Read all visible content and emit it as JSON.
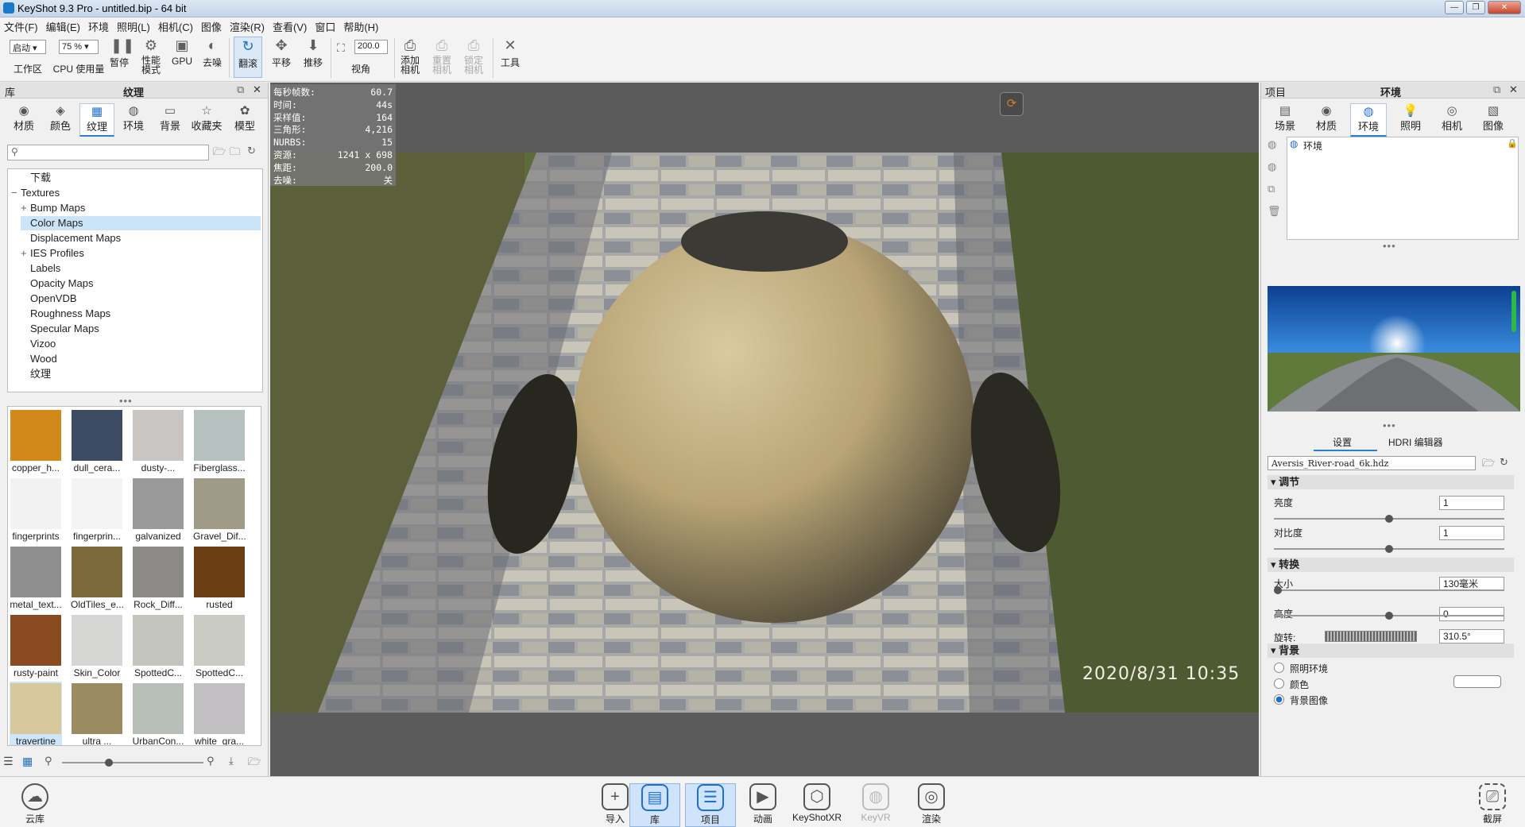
{
  "window": {
    "title": "KeyShot 9.3 Pro  - untitled.bip  - 64 bit",
    "minimize": "—",
    "restore": "❐",
    "close": "✕"
  },
  "menu": [
    "文件(F)",
    "编辑(E)",
    "环境",
    "照明(L)",
    "相机(C)",
    "图像",
    "渲染(R)",
    "查看(V)",
    "窗口",
    "帮助(H)"
  ],
  "toolbar": {
    "workspace_value": "启动",
    "workspace_label": "工作区",
    "cpu_value": "75 %",
    "cpu_label": "CPU 使用量",
    "pause": "暂停",
    "perf": "性能\n模式",
    "gpu": "GPU",
    "denoise": "去噪",
    "tumble": "翻滚",
    "pan": "平移",
    "dolly": "推移",
    "fov_value": "200.0",
    "fov_label": "视角",
    "add_camera": "添加\n相机",
    "reset_camera": "重置\n相机",
    "lock_camera": "锁定\n相机",
    "tools": "工具"
  },
  "library": {
    "header": "库",
    "title": "纹理",
    "tabs": [
      "材质",
      "颜色",
      "纹理",
      "环境",
      "背景",
      "收藏夹",
      "模型"
    ],
    "active_tab": "纹理",
    "search_placeholder": "",
    "tree": [
      {
        "label": "下载",
        "indent": 1,
        "toggle": ""
      },
      {
        "label": "Textures",
        "indent": 0,
        "toggle": "−"
      },
      {
        "label": "Bump Maps",
        "indent": 1,
        "toggle": "+"
      },
      {
        "label": "Color Maps",
        "indent": 1,
        "toggle": "",
        "selected": true
      },
      {
        "label": "Displacement Maps",
        "indent": 1,
        "toggle": ""
      },
      {
        "label": "IES Profiles",
        "indent": 1,
        "toggle": "+"
      },
      {
        "label": "Labels",
        "indent": 1,
        "toggle": ""
      },
      {
        "label": "Opacity Maps",
        "indent": 1,
        "toggle": ""
      },
      {
        "label": "OpenVDB",
        "indent": 1,
        "toggle": ""
      },
      {
        "label": "Roughness Maps",
        "indent": 1,
        "toggle": ""
      },
      {
        "label": "Specular Maps",
        "indent": 1,
        "toggle": ""
      },
      {
        "label": "Vizoo",
        "indent": 1,
        "toggle": ""
      },
      {
        "label": "Wood",
        "indent": 1,
        "toggle": ""
      },
      {
        "label": "纹理",
        "indent": 1,
        "toggle": ""
      }
    ],
    "thumbnails": [
      {
        "label": "copper_h...",
        "color": "#d18a1a"
      },
      {
        "label": "dull_cera...",
        "color": "#3d4c62"
      },
      {
        "label": "dusty-...",
        "color": "#c9c5c3"
      },
      {
        "label": "Fiberglass...",
        "color": "#b6c1bf"
      },
      {
        "label": "fingerprints",
        "color": "#f2f2f2"
      },
      {
        "label": "fingerprin...",
        "color": "#f4f4f4"
      },
      {
        "label": "galvanized",
        "color": "#9a9a9a"
      },
      {
        "label": "Gravel_Dif...",
        "color": "#a09a88"
      },
      {
        "label": "metal_text...",
        "color": "#8f8f8f"
      },
      {
        "label": "OldTiles_e...",
        "color": "#7d6a3c"
      },
      {
        "label": "Rock_Diff...",
        "color": "#8c8a86"
      },
      {
        "label": "rusted",
        "color": "#6b3e14"
      },
      {
        "label": "rusty-paint",
        "color": "#8a4a22"
      },
      {
        "label": "Skin_Color",
        "color": "#d6d6d4"
      },
      {
        "label": "SpottedC...",
        "color": "#c3c4bc"
      },
      {
        "label": "SpottedC...",
        "color": "#c9cbc2"
      },
      {
        "label": "travertine",
        "color": "#d8c99c",
        "selected": true
      },
      {
        "label": "ultra ...",
        "color": "#9a8b62"
      },
      {
        "label": "UrbanCon...",
        "color": "#b7bfb8"
      },
      {
        "label": "white_gra...",
        "color": "#c2bfc3"
      }
    ]
  },
  "hud": [
    {
      "k": "每秒帧数:",
      "v": "60.7"
    },
    {
      "k": "时间:",
      "v": "44s"
    },
    {
      "k": "采样值:",
      "v": "164"
    },
    {
      "k": "三角形:",
      "v": "4,216"
    },
    {
      "k": "NURBS:",
      "v": "15"
    },
    {
      "k": "资源:",
      "v": "1241 x 698"
    },
    {
      "k": "焦距:",
      "v": "200.0"
    },
    {
      "k": "去噪:",
      "v": "关"
    }
  ],
  "viewport": {
    "timestamp": "2020/8/31  10:35"
  },
  "project": {
    "header": "项目",
    "title": "环境",
    "tabs": [
      "场景",
      "材质",
      "环境",
      "照明",
      "相机",
      "图像"
    ],
    "active_tab": "环境",
    "env_item": "环境",
    "subtabs": [
      "设置",
      "HDRI 编辑器"
    ],
    "hdr_file": "Aversis_River-road_6k.hdz",
    "adjust": {
      "label": "调节",
      "brightness_label": "亮度",
      "brightness": "1",
      "brightness_level": 0.5,
      "contrast_label": "对比度",
      "contrast": "1",
      "contrast_level": 0.5
    },
    "transform": {
      "label": "转换",
      "size_label": "大小",
      "size": "130毫米",
      "size_level": 0.0,
      "height_label": "高度",
      "height": "0",
      "height_level": 0.5,
      "rotation_label": "旋转:",
      "rotation": "310.5°"
    },
    "background": {
      "label": "背景",
      "opt1": "照明环境",
      "opt2": "颜色",
      "opt3": "背景图像",
      "selected": 3
    }
  },
  "bottom": {
    "cloud": "云库",
    "items": [
      {
        "label": "导入",
        "icon": "+"
      },
      {
        "label": "库",
        "icon": "▤",
        "on": true
      },
      {
        "label": "项目",
        "icon": "☰",
        "on": true
      },
      {
        "label": "动画",
        "icon": "▶"
      },
      {
        "label": "KeyShotXR",
        "icon": "⬡"
      },
      {
        "label": "KeyVR",
        "icon": "◍",
        "dis": true
      },
      {
        "label": "渲染",
        "icon": "◎"
      }
    ],
    "screenshot": "截屏"
  }
}
